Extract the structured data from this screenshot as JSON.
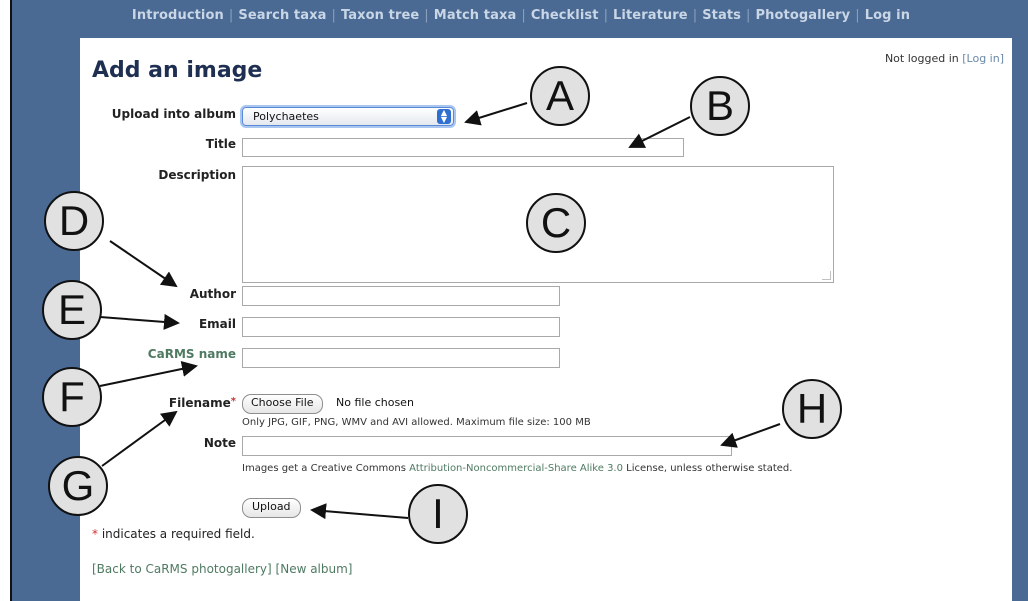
{
  "nav": [
    "Introduction",
    "Search taxa",
    "Taxon tree",
    "Match taxa",
    "Checklist",
    "Literature",
    "Stats",
    "Photogallery",
    "Log in"
  ],
  "login_status": {
    "text": "Not logged in",
    "link": "[Log in]"
  },
  "page_title": "Add an image",
  "form": {
    "album_label": "Upload into album",
    "album_value": "Polychaetes",
    "title_label": "Title",
    "description_label": "Description",
    "author_label": "Author",
    "email_label": "Email",
    "carms_label": "CaRMS name",
    "filename_label": "Filename",
    "filename_required_mark": "*",
    "choose_file_label": "Choose File",
    "file_status": "No file chosen",
    "file_hint": "Only JPG, GIF, PNG, WMV and AVI allowed. Maximum file size: 100 MB",
    "note_label": "Note",
    "license_prefix": "Images get a Creative Commons ",
    "license_link": "Attribution-Noncommercial-Share Alike 3.0",
    "license_suffix": " License, unless otherwise stated.",
    "upload_label": "Upload"
  },
  "required_note": {
    "star": "*",
    "text": " indicates a required field."
  },
  "footer_links": [
    "[Back to CaRMS photogallery]",
    "[New album]"
  ],
  "callouts": [
    "A",
    "B",
    "C",
    "D",
    "E",
    "F",
    "G",
    "H",
    "I"
  ]
}
